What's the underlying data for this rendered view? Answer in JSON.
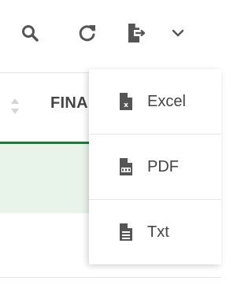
{
  "toolbar": {
    "icons": [
      "search-icon",
      "refresh-icon",
      "export-icon",
      "chevron-down-icon"
    ]
  },
  "table": {
    "column_header": "FINA"
  },
  "export_menu": {
    "items": [
      {
        "label": "Excel",
        "icon": "excel-file-icon"
      },
      {
        "label": "PDF",
        "icon": "pdf-file-icon"
      },
      {
        "label": "Txt",
        "icon": "text-file-icon"
      }
    ]
  },
  "colors": {
    "icon": "#555555",
    "accent_green": "#1f7a3a",
    "row_highlight": "#e8f3ea"
  }
}
